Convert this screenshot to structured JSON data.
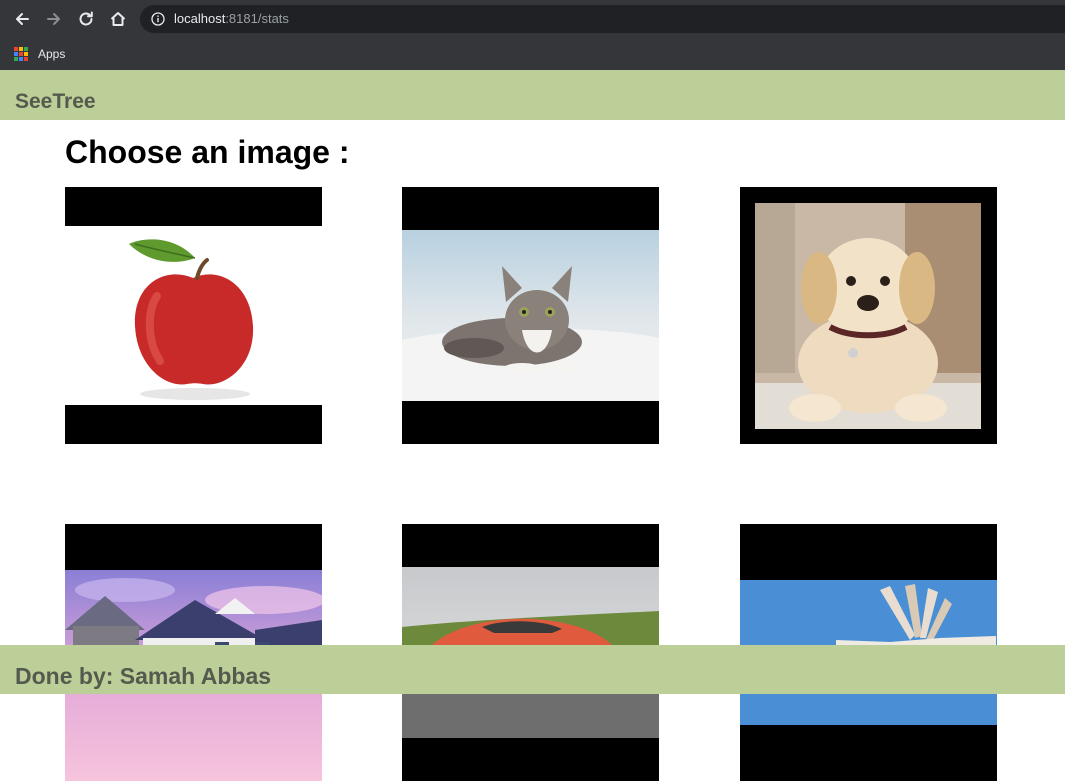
{
  "browser": {
    "url_host": "localhost",
    "url_rest": ":8181/stats",
    "bookmark_apps_label": "Apps",
    "icons": [
      "back-icon",
      "forward-icon",
      "reload-icon",
      "home-icon",
      "info-icon",
      "apps-grid-icon"
    ]
  },
  "header": {
    "brand": "SeeTree"
  },
  "main": {
    "title": "Choose an image :",
    "images": [
      {
        "subject": "apple"
      },
      {
        "subject": "cat"
      },
      {
        "subject": "dog"
      },
      {
        "subject": "house"
      },
      {
        "subject": "car"
      },
      {
        "subject": "book"
      }
    ]
  },
  "footer": {
    "text": "Done by: Samah Abbas"
  },
  "colors": {
    "accent": "#bccf98",
    "accent_text": "#555a4e",
    "chrome": "#35363a",
    "omnibox": "#202124"
  }
}
